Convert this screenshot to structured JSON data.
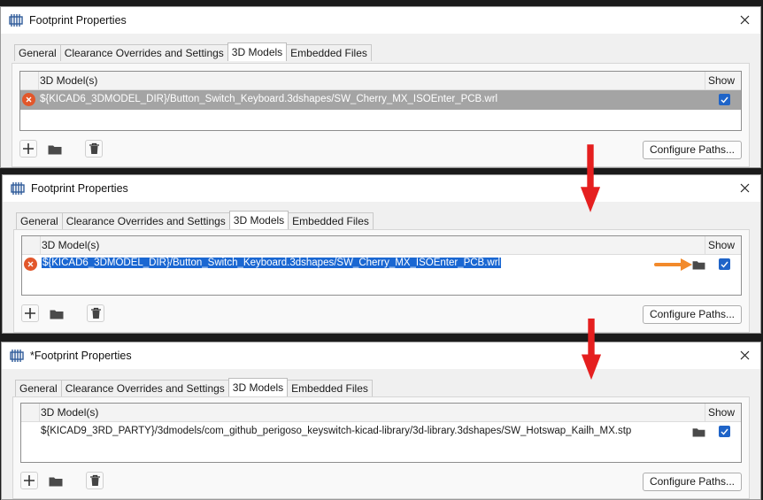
{
  "panels": [
    {
      "title": "Footprint Properties",
      "tabs": [
        "General",
        "Clearance Overrides and Settings",
        "3D Models",
        "Embedded Files"
      ],
      "active_tab": 2,
      "grid": {
        "col_model": "3D Model(s)",
        "col_show": "Show"
      },
      "row": {
        "path": "${KICAD6_3DMODEL_DIR}/Button_Switch_Keyboard.3dshapes/SW_Cherry_MX_ISOEnter_PCB.wrl",
        "error": true,
        "show": true
      },
      "configure_label": "Configure Paths..."
    },
    {
      "title": "Footprint Properties",
      "tabs": [
        "General",
        "Clearance Overrides and Settings",
        "3D Models",
        "Embedded Files"
      ],
      "active_tab": 2,
      "grid": {
        "col_model": "3D Model(s)",
        "col_show": "Show"
      },
      "row": {
        "path": "${KICAD6_3DMODEL_DIR}/Button_Switch_Keyboard.3dshapes/SW_Cherry_MX_ISOEnter_PCB.wrl",
        "error": true,
        "show": true
      },
      "configure_label": "Configure Paths..."
    },
    {
      "title": "*Footprint Properties",
      "tabs": [
        "General",
        "Clearance Overrides and Settings",
        "3D Models",
        "Embedded Files"
      ],
      "active_tab": 2,
      "grid": {
        "col_model": "3D Model(s)",
        "col_show": "Show"
      },
      "row": {
        "path": "${KICAD9_3RD_PARTY}/3dmodels/com_github_perigoso_keyswitch-kicad-library/3d-library.3dshapes/SW_Hotswap_Kailh_MX.stp",
        "error": false,
        "show": true
      },
      "configure_label": "Configure Paths..."
    }
  ],
  "colors": {
    "step_arrow": "#e51f1f",
    "hint_arrow": "#f28a2b",
    "selection": "#1a67d2",
    "error_icon": "#e2572b"
  },
  "icons": [
    "footprint-app-icon",
    "close-icon",
    "error-icon",
    "folder-icon",
    "checkbox-checked-icon",
    "add-icon",
    "trash-icon",
    "down-arrow-icon",
    "right-arrow-icon"
  ]
}
